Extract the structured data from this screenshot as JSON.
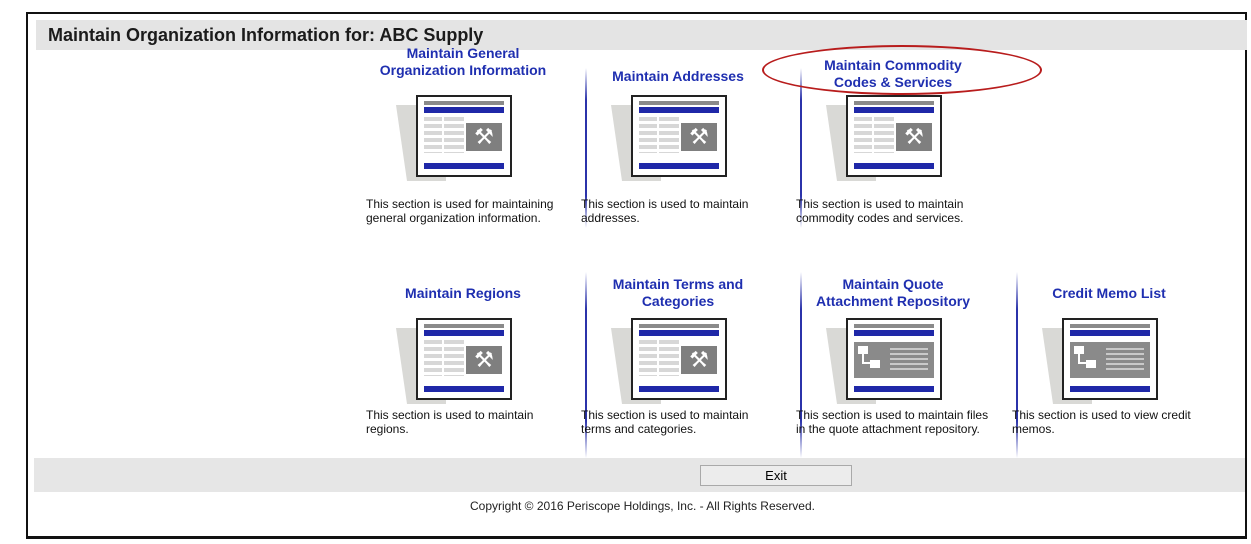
{
  "page": {
    "title": "Maintain Organization Information for: ABC Supply"
  },
  "cards": [
    {
      "title_l1": "Maintain General",
      "title_l2": "Organization Information",
      "icon": "tools-doc-icon",
      "desc": "This section is used for maintaining general organization information."
    },
    {
      "title_l1": "Maintain Addresses",
      "title_l2": "",
      "icon": "tools-doc-icon",
      "desc": "This section is used to maintain addresses."
    },
    {
      "title_l1": "Maintain Commodity",
      "title_l2": "Codes & Services",
      "icon": "tools-doc-icon",
      "desc": "This section is used to maintain commodity codes and services."
    },
    {
      "title_l1": "Maintain Regions",
      "title_l2": "",
      "icon": "tools-doc-icon",
      "desc": "This section is used to maintain regions."
    },
    {
      "title_l1": "Maintain Terms and",
      "title_l2": "Categories",
      "icon": "tools-doc-icon",
      "desc": "This section is used to maintain terms and categories."
    },
    {
      "title_l1": "Maintain Quote",
      "title_l2": "Attachment Repository",
      "icon": "flowchart-doc-icon",
      "desc": "This section is used to maintain files in the quote attachment repository."
    },
    {
      "title_l1": "Credit Memo List",
      "title_l2": "",
      "icon": "flowchart-doc-icon",
      "desc": "This section is used to view credit memos."
    }
  ],
  "footer": {
    "exit_label": "Exit",
    "copyright": "Copyright © 2016 Periscope Holdings, Inc. - All Rights Reserved."
  },
  "colors": {
    "link": "#1f2fb0",
    "accent_bar": "#1f28a8",
    "highlight": "#b81c1c"
  }
}
